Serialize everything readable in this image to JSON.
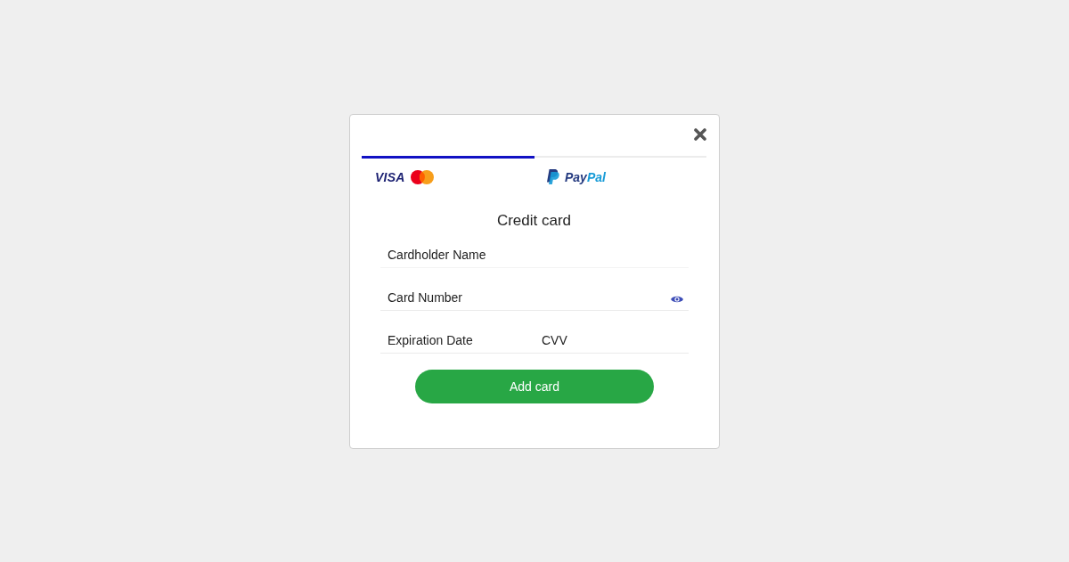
{
  "dialog": {
    "tabs": [
      {
        "kind": "cards",
        "label": "VISA",
        "selected": true
      },
      {
        "kind": "paypal",
        "label_parts": [
          {
            "text": "Pay",
            "color": "#253b80"
          },
          {
            "text": "Pal",
            "color": "#179bd7"
          }
        ],
        "selected": false
      }
    ],
    "title": "Credit card",
    "field_rows": [
      [
        {
          "kind": "text",
          "placeholder": "Cardholder Name"
        }
      ],
      [
        {
          "kind": "revealable",
          "placeholder": "Card Number"
        }
      ],
      [
        {
          "kind": "text",
          "placeholder": "Expiration Date"
        },
        {
          "kind": "text",
          "placeholder": "CVV"
        }
      ]
    ],
    "submit_button": "Add card"
  }
}
